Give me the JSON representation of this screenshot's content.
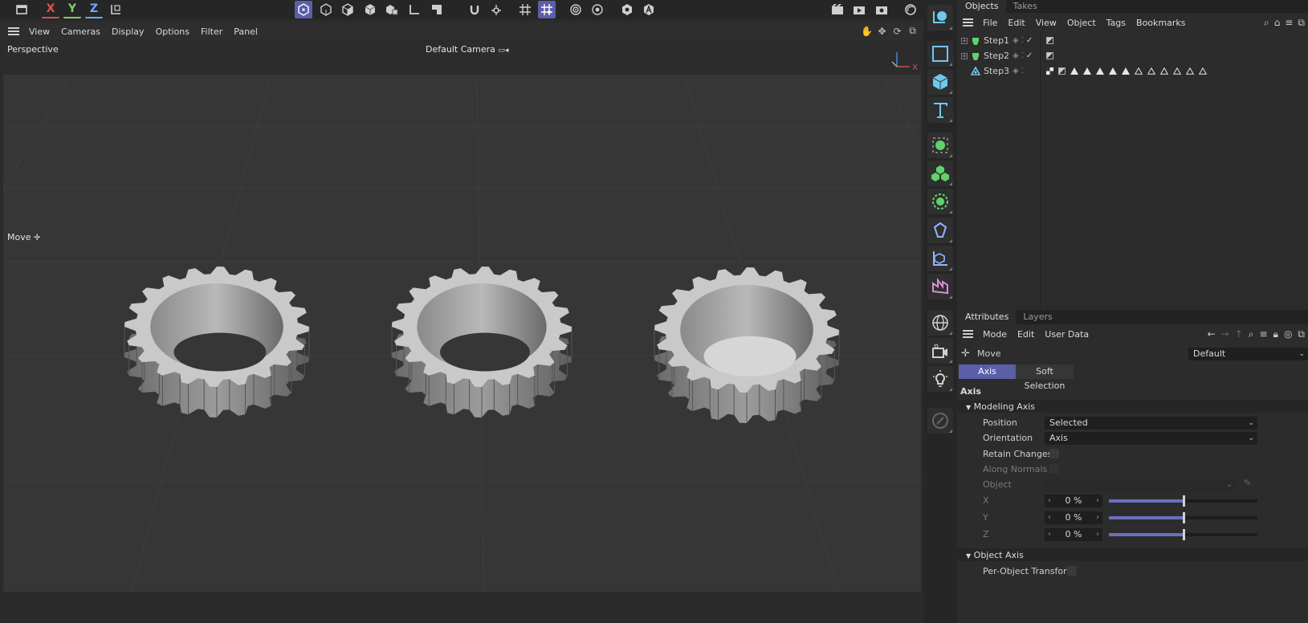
{
  "toolbar": {
    "axis_x": "X",
    "axis_y": "Y",
    "axis_z": "Z"
  },
  "viewport_menu": [
    "View",
    "Cameras",
    "Display",
    "Options",
    "Filter",
    "Panel"
  ],
  "viewport": {
    "view_name": "Perspective",
    "camera": "Default Camera",
    "tool_label": "Move",
    "axis_label_x": "X"
  },
  "objects_panel": {
    "tabs": [
      "Objects",
      "Takes"
    ],
    "menu": [
      "File",
      "Edit",
      "View",
      "Object",
      "Tags",
      "Bookmarks"
    ],
    "items": [
      {
        "name": "Step1",
        "expandable": true
      },
      {
        "name": "Step2",
        "expandable": true
      },
      {
        "name": "Step3",
        "expandable": false
      }
    ]
  },
  "attributes_panel": {
    "tabs": [
      "Attributes",
      "Layers"
    ],
    "menu": [
      "Mode",
      "Edit",
      "User Data"
    ],
    "tool_name": "Move",
    "preset": "Default",
    "subtabs": [
      "Axis",
      "Soft Selection"
    ],
    "section_title": "Axis",
    "modeling_axis": {
      "title": "Modeling Axis",
      "position_label": "Position",
      "position_value": "Selected",
      "orientation_label": "Orientation",
      "orientation_value": "Axis",
      "retain_changes_label": "Retain Changes",
      "along_normals_label": "Along Normals",
      "object_label": "Object",
      "x_label": "X",
      "x_value": "0 %",
      "y_label": "Y",
      "y_value": "0 %",
      "z_label": "Z",
      "z_value": "0 %",
      "x_level_percent": 50,
      "y_level_percent": 50,
      "z_level_percent": 50
    },
    "object_axis": {
      "title": "Object Axis",
      "per_object_label": "Per-Object Transform"
    }
  },
  "colors": {
    "accent": "#5a5fa8",
    "slider_fill": "#6a6fc0",
    "axis_x": "#e05050",
    "axis_y": "#7fcf6f",
    "axis_z": "#6fa8ff",
    "palette_icon": "#6fc8f0",
    "green_icon": "#5fd36a",
    "magenta_icon": "#d88fd8"
  }
}
